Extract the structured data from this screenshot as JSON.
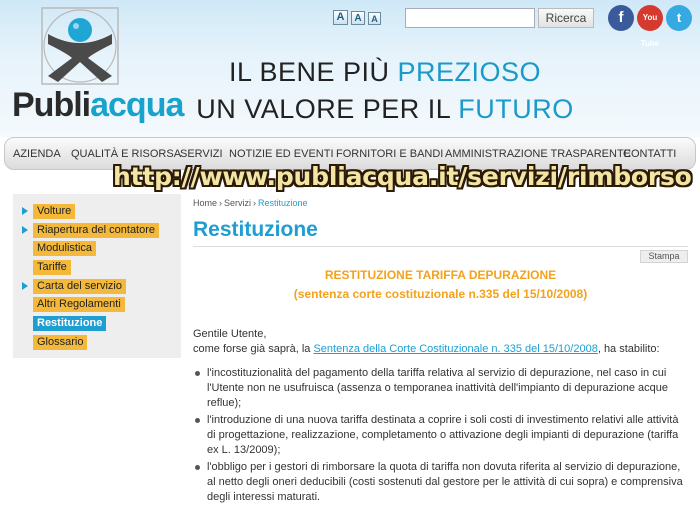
{
  "header": {
    "logo": {
      "part1": "Publi",
      "part2": "acqua"
    },
    "font_size_buttons": [
      "A",
      "A",
      "A"
    ],
    "search": {
      "value": "",
      "placeholder": "",
      "button_label": "Ricerca"
    },
    "social": {
      "facebook": "f",
      "youtube": "You Tube",
      "twitter": "t"
    },
    "slogan": {
      "line1_plain": "IL BENE PIÙ ",
      "line1_accent": "PREZIOSO",
      "line2_plain": "UN VALORE PER IL ",
      "line2_accent": "FUTURO"
    }
  },
  "nav": {
    "items": [
      "AZIENDA",
      "QUALITÀ E RISORSA",
      "SERVIZI",
      "NOTIZIE ED EVENTI",
      "FORNITORI E BANDI",
      "AMMINISTRAZIONE TRASPARENTE",
      "CONTATTI"
    ]
  },
  "overlay_url": "http://www.publiacqua.it/servizi/rimborso",
  "sidebar": {
    "items": [
      {
        "label": "Volture",
        "arrow": true,
        "active": false
      },
      {
        "label": "Riapertura del contatore",
        "arrow": true,
        "active": false
      },
      {
        "label": "Modulistica",
        "arrow": false,
        "active": false
      },
      {
        "label": "Tariffe",
        "arrow": false,
        "active": false
      },
      {
        "label": "Carta del servizio",
        "arrow": true,
        "active": false
      },
      {
        "label": "Altri Regolamenti",
        "arrow": false,
        "active": false
      },
      {
        "label": "Restituzione",
        "arrow": false,
        "active": true
      },
      {
        "label": "Glossario",
        "arrow": false,
        "active": false
      }
    ]
  },
  "breadcrumb": {
    "home": "Home",
    "sep1": "›",
    "services": "Servizi",
    "sep2": "›",
    "current": "Restituzione"
  },
  "page": {
    "title": "Restituzione",
    "print_label": "Stampa",
    "subtitle1": "RESTITUZIONE TARIFFA DEPURAZIONE",
    "subtitle2": "(sentenza corte costituzionale n.335 del 15/10/2008)",
    "greeting": "Gentile Utente,",
    "intro_before": "come forse già saprà, la ",
    "intro_link": "Sentenza della Corte Costituzionale n. 335 del 15/10/2008",
    "intro_after": ", ha stabilito:",
    "bullets": [
      "l'incostituzionalità del pagamento della tariffa relativa al servizio di depurazione, nel caso in cui l'Utente non ne usufruisca (assenza o temporanea inattività dell'impianto di depurazione acque reflue);",
      "l'introduzione di una nuova tariffa destinata a coprire i soli costi di investimento relativi alle attività di progettazione, realizzazione, completamento o attivazione degli impianti di depurazione (tariffa ex L. 13/2009);",
      "l'obbligo per i gestori di rimborsare la quota di tariffa non dovuta riferita al servizio di depurazione, al netto degli oneri deducibili (costi sostenuti dal gestore per le attività di cui sopra) e comprensiva degli interessi maturati."
    ]
  },
  "colors": {
    "accent": "#1e9ed1",
    "sidebar_item": "#f4b93a",
    "subtitle": "#f3a21b"
  }
}
